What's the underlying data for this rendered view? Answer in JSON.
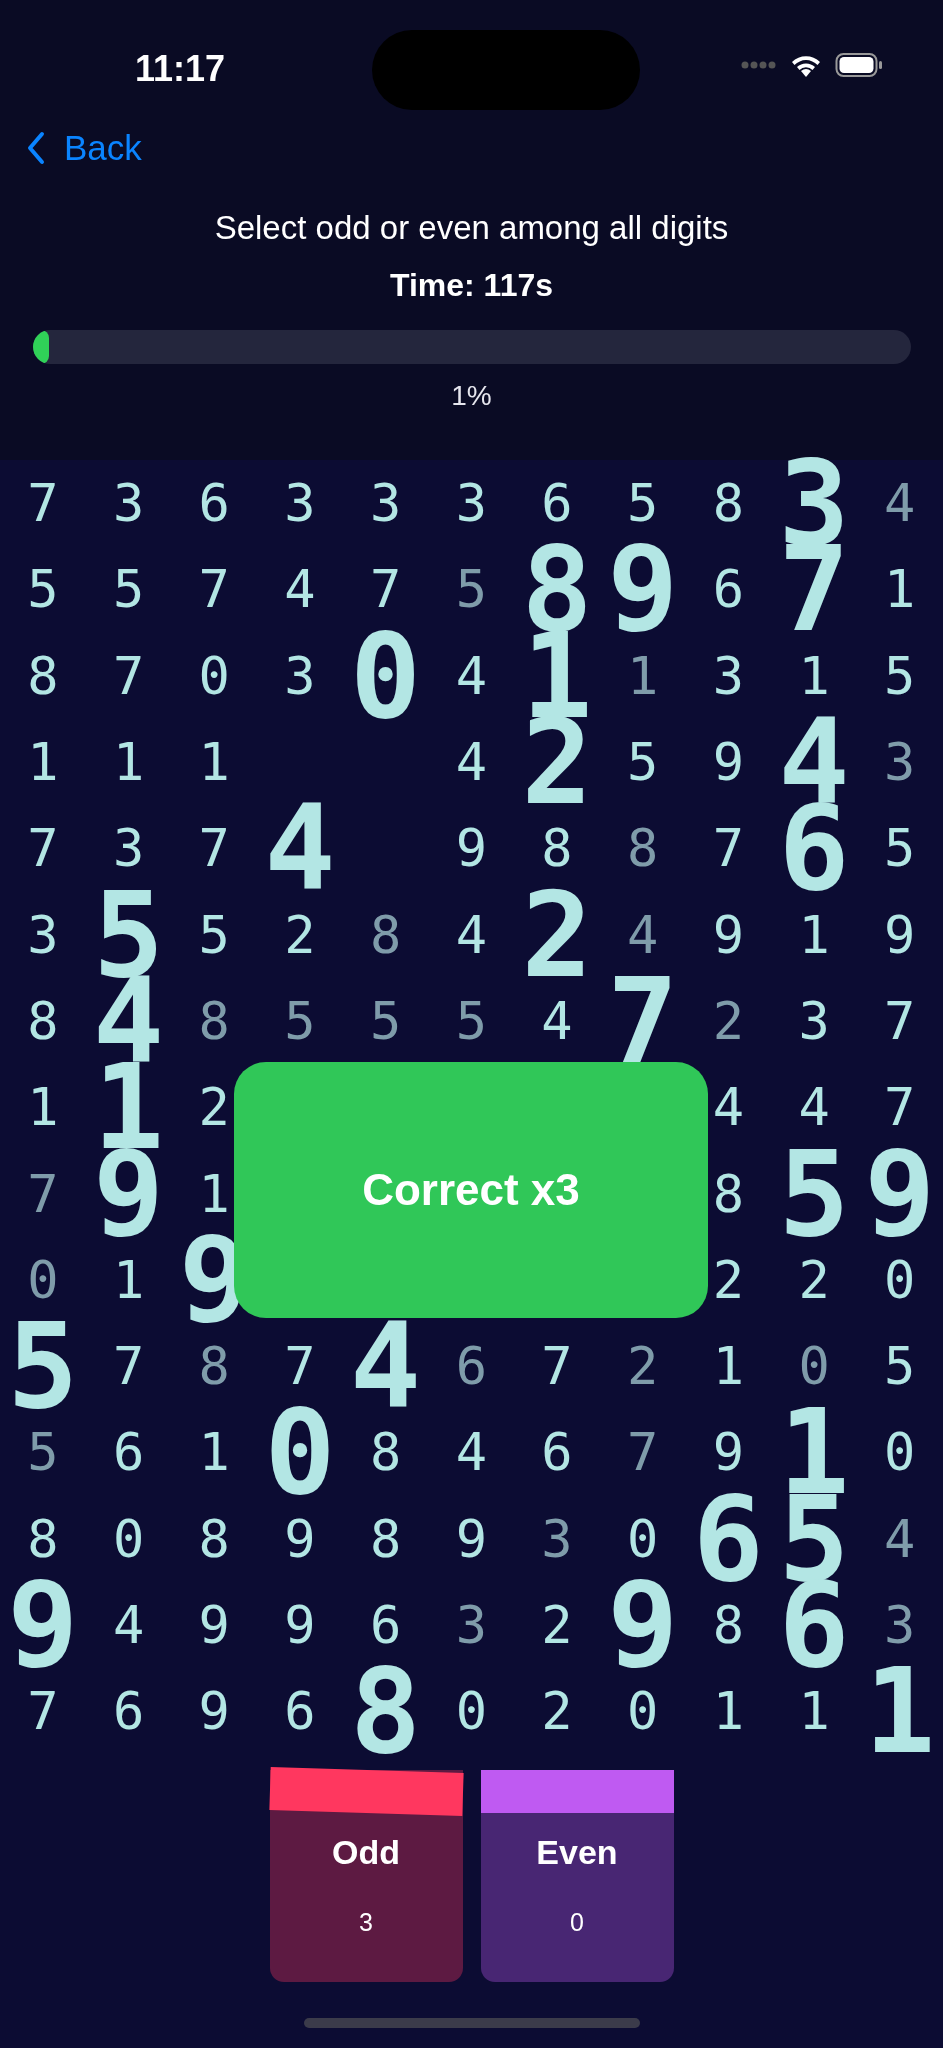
{
  "status_bar": {
    "time": "11:17"
  },
  "nav": {
    "back": "Back"
  },
  "instruction": "Select odd or even among all digits",
  "timer": "Time: 117s",
  "progress": {
    "level": 0.01,
    "label": "1%"
  },
  "grid": [
    [
      {
        "d": "7",
        "kind": "normal"
      },
      {
        "d": "3",
        "kind": "normal"
      },
      {
        "d": "6",
        "kind": "normal"
      },
      {
        "d": "3",
        "kind": "normal"
      },
      {
        "d": "3",
        "kind": "normal"
      },
      {
        "d": "3",
        "kind": "normal"
      },
      {
        "d": "6",
        "kind": "normal"
      },
      {
        "d": "5",
        "kind": "normal"
      },
      {
        "d": "8",
        "kind": "normal"
      },
      {
        "d": "3",
        "kind": "big"
      },
      {
        "d": "4",
        "kind": "dim"
      }
    ],
    [
      {
        "d": "5",
        "kind": "normal"
      },
      {
        "d": "5",
        "kind": "normal"
      },
      {
        "d": "7",
        "kind": "normal"
      },
      {
        "d": "4",
        "kind": "normal"
      },
      {
        "d": "7",
        "kind": "normal"
      },
      {
        "d": "5",
        "kind": "dim"
      },
      {
        "d": "8",
        "kind": "big"
      },
      {
        "d": "9",
        "kind": "big"
      },
      {
        "d": "6",
        "kind": "normal"
      },
      {
        "d": "7",
        "kind": "big"
      },
      {
        "d": "1",
        "kind": "normal"
      }
    ],
    [
      {
        "d": "8",
        "kind": "normal"
      },
      {
        "d": "7",
        "kind": "normal"
      },
      {
        "d": "0",
        "kind": "normal"
      },
      {
        "d": "3",
        "kind": "normal"
      },
      {
        "d": "0",
        "kind": "big"
      },
      {
        "d": "4",
        "kind": "normal"
      },
      {
        "d": "1",
        "kind": "big"
      },
      {
        "d": "1",
        "kind": "dim"
      },
      {
        "d": "3",
        "kind": "normal"
      },
      {
        "d": "1",
        "kind": "normal"
      },
      {
        "d": "5",
        "kind": "normal"
      }
    ],
    [
      {
        "d": "1",
        "kind": "normal"
      },
      {
        "d": "1",
        "kind": "normal"
      },
      {
        "d": "1",
        "kind": "normal"
      },
      {
        "kind": "blank"
      },
      {
        "kind": "blank"
      },
      {
        "d": "4",
        "kind": "normal"
      },
      {
        "d": "2",
        "kind": "big"
      },
      {
        "d": "5",
        "kind": "normal"
      },
      {
        "d": "9",
        "kind": "normal"
      },
      {
        "d": "4",
        "kind": "big"
      },
      {
        "d": "3",
        "kind": "dim"
      }
    ],
    [
      {
        "d": "7",
        "kind": "normal"
      },
      {
        "d": "3",
        "kind": "normal"
      },
      {
        "d": "7",
        "kind": "normal"
      },
      {
        "d": "4",
        "kind": "big"
      },
      {
        "kind": "blank"
      },
      {
        "d": "9",
        "kind": "normal"
      },
      {
        "d": "8",
        "kind": "normal"
      },
      {
        "d": "8",
        "kind": "dim"
      },
      {
        "d": "7",
        "kind": "normal"
      },
      {
        "d": "6",
        "kind": "big"
      },
      {
        "d": "5",
        "kind": "normal"
      }
    ],
    [
      {
        "d": "3",
        "kind": "normal"
      },
      {
        "d": "5",
        "kind": "big"
      },
      {
        "d": "5",
        "kind": "normal"
      },
      {
        "d": "2",
        "kind": "normal"
      },
      {
        "d": "8",
        "kind": "dim"
      },
      {
        "d": "4",
        "kind": "normal"
      },
      {
        "d": "2",
        "kind": "big"
      },
      {
        "d": "4",
        "kind": "dim"
      },
      {
        "d": "9",
        "kind": "normal"
      },
      {
        "d": "1",
        "kind": "normal"
      },
      {
        "d": "9",
        "kind": "normal"
      }
    ],
    [
      {
        "d": "8",
        "kind": "normal"
      },
      {
        "d": "4",
        "kind": "big"
      },
      {
        "d": "8",
        "kind": "dim"
      },
      {
        "d": "5",
        "kind": "dim"
      },
      {
        "d": "5",
        "kind": "dim"
      },
      {
        "d": "5",
        "kind": "dim"
      },
      {
        "d": "4",
        "kind": "normal"
      },
      {
        "d": "7",
        "kind": "big"
      },
      {
        "d": "2",
        "kind": "dim"
      },
      {
        "d": "3",
        "kind": "normal"
      },
      {
        "d": "7",
        "kind": "normal"
      }
    ],
    [
      {
        "d": "1",
        "kind": "normal"
      },
      {
        "d": "1",
        "kind": "big"
      },
      {
        "d": "2",
        "kind": "normal"
      },
      {
        "kind": "blank"
      },
      {
        "kind": "blank"
      },
      {
        "kind": "blank"
      },
      {
        "kind": "blank"
      },
      {
        "kind": "blank"
      },
      {
        "d": "4",
        "kind": "normal"
      },
      {
        "d": "4",
        "kind": "normal"
      },
      {
        "d": "7",
        "kind": "normal"
      }
    ],
    [
      {
        "d": "7",
        "kind": "dim"
      },
      {
        "d": "9",
        "kind": "big"
      },
      {
        "d": "1",
        "kind": "normal"
      },
      {
        "kind": "blank"
      },
      {
        "kind": "blank"
      },
      {
        "kind": "blank"
      },
      {
        "kind": "blank"
      },
      {
        "kind": "blank"
      },
      {
        "d": "8",
        "kind": "normal"
      },
      {
        "d": "5",
        "kind": "big"
      },
      {
        "d": "9",
        "kind": "big"
      }
    ],
    [
      {
        "d": "0",
        "kind": "dim"
      },
      {
        "d": "1",
        "kind": "normal"
      },
      {
        "d": "9",
        "kind": "big"
      },
      {
        "kind": "blank"
      },
      {
        "kind": "blank"
      },
      {
        "kind": "blank"
      },
      {
        "kind": "blank"
      },
      {
        "kind": "blank"
      },
      {
        "d": "2",
        "kind": "normal"
      },
      {
        "d": "2",
        "kind": "normal"
      },
      {
        "d": "0",
        "kind": "normal"
      }
    ],
    [
      {
        "d": "5",
        "kind": "big"
      },
      {
        "d": "7",
        "kind": "normal"
      },
      {
        "d": "8",
        "kind": "dim"
      },
      {
        "d": "7",
        "kind": "normal"
      },
      {
        "d": "4",
        "kind": "big"
      },
      {
        "d": "6",
        "kind": "dim"
      },
      {
        "d": "7",
        "kind": "normal"
      },
      {
        "d": "2",
        "kind": "dim"
      },
      {
        "d": "1",
        "kind": "normal"
      },
      {
        "d": "0",
        "kind": "dim"
      },
      {
        "d": "5",
        "kind": "normal"
      }
    ],
    [
      {
        "d": "5",
        "kind": "dim"
      },
      {
        "d": "6",
        "kind": "normal"
      },
      {
        "d": "1",
        "kind": "normal"
      },
      {
        "d": "0",
        "kind": "big"
      },
      {
        "d": "8",
        "kind": "normal"
      },
      {
        "d": "4",
        "kind": "normal"
      },
      {
        "d": "6",
        "kind": "normal"
      },
      {
        "d": "7",
        "kind": "dim"
      },
      {
        "d": "9",
        "kind": "normal"
      },
      {
        "d": "1",
        "kind": "big"
      },
      {
        "d": "0",
        "kind": "normal"
      }
    ],
    [
      {
        "d": "8",
        "kind": "normal"
      },
      {
        "d": "0",
        "kind": "normal"
      },
      {
        "d": "8",
        "kind": "normal"
      },
      {
        "d": "9",
        "kind": "normal"
      },
      {
        "d": "8",
        "kind": "normal"
      },
      {
        "d": "9",
        "kind": "normal"
      },
      {
        "d": "3",
        "kind": "dim"
      },
      {
        "d": "0",
        "kind": "normal"
      },
      {
        "d": "6",
        "kind": "big"
      },
      {
        "d": "5",
        "kind": "big"
      },
      {
        "d": "4",
        "kind": "dim"
      }
    ],
    [
      {
        "d": "9",
        "kind": "big"
      },
      {
        "d": "4",
        "kind": "normal"
      },
      {
        "d": "9",
        "kind": "normal"
      },
      {
        "d": "9",
        "kind": "normal"
      },
      {
        "d": "6",
        "kind": "normal"
      },
      {
        "d": "3",
        "kind": "dim"
      },
      {
        "d": "2",
        "kind": "normal"
      },
      {
        "d": "9",
        "kind": "big"
      },
      {
        "d": "8",
        "kind": "normal"
      },
      {
        "d": "6",
        "kind": "big"
      },
      {
        "d": "3",
        "kind": "dim"
      }
    ],
    [
      {
        "d": "7",
        "kind": "normal"
      },
      {
        "d": "6",
        "kind": "normal"
      },
      {
        "d": "9",
        "kind": "normal"
      },
      {
        "d": "6",
        "kind": "normal"
      },
      {
        "d": "8",
        "kind": "big"
      },
      {
        "d": "0",
        "kind": "normal"
      },
      {
        "d": "2",
        "kind": "normal"
      },
      {
        "d": "0",
        "kind": "normal"
      },
      {
        "d": "1",
        "kind": "normal"
      },
      {
        "d": "1",
        "kind": "normal"
      },
      {
        "d": "1",
        "kind": "big"
      }
    ]
  ],
  "toast": "Correct x3",
  "bins": [
    {
      "label": "Odd",
      "count": "3",
      "color": "#ff375f",
      "tilted": true
    },
    {
      "label": "Even",
      "count": "0",
      "color": "#bf5af2",
      "tilted": false
    }
  ]
}
